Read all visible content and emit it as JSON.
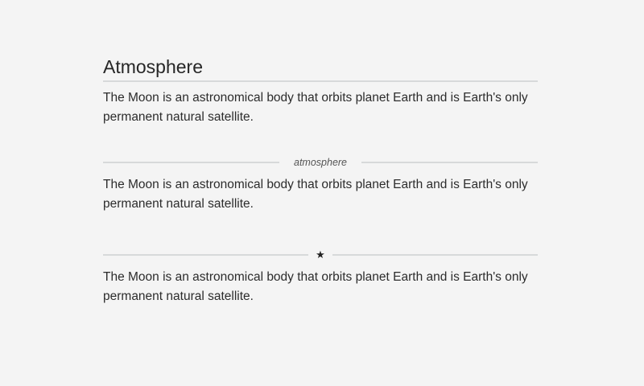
{
  "heading": {
    "title": "Atmosphere"
  },
  "sections": [
    {
      "text": "The Moon is an astronomical body that orbits planet Earth and is Earth's only permanent natural satellite."
    },
    {
      "divider_label": "atmosphere",
      "text": "The Moon is an astronomical body that orbits planet Earth and is Earth's only permanent natural satellite."
    },
    {
      "divider_icon": "star-icon",
      "divider_glyph": "★",
      "text": "The Moon is an astronomical body that orbits planet Earth and is Earth's only permanent natural satellite."
    }
  ],
  "colors": {
    "background": "#f4f4f4",
    "divider": "#d7d9da",
    "text": "#2c2c2c"
  }
}
